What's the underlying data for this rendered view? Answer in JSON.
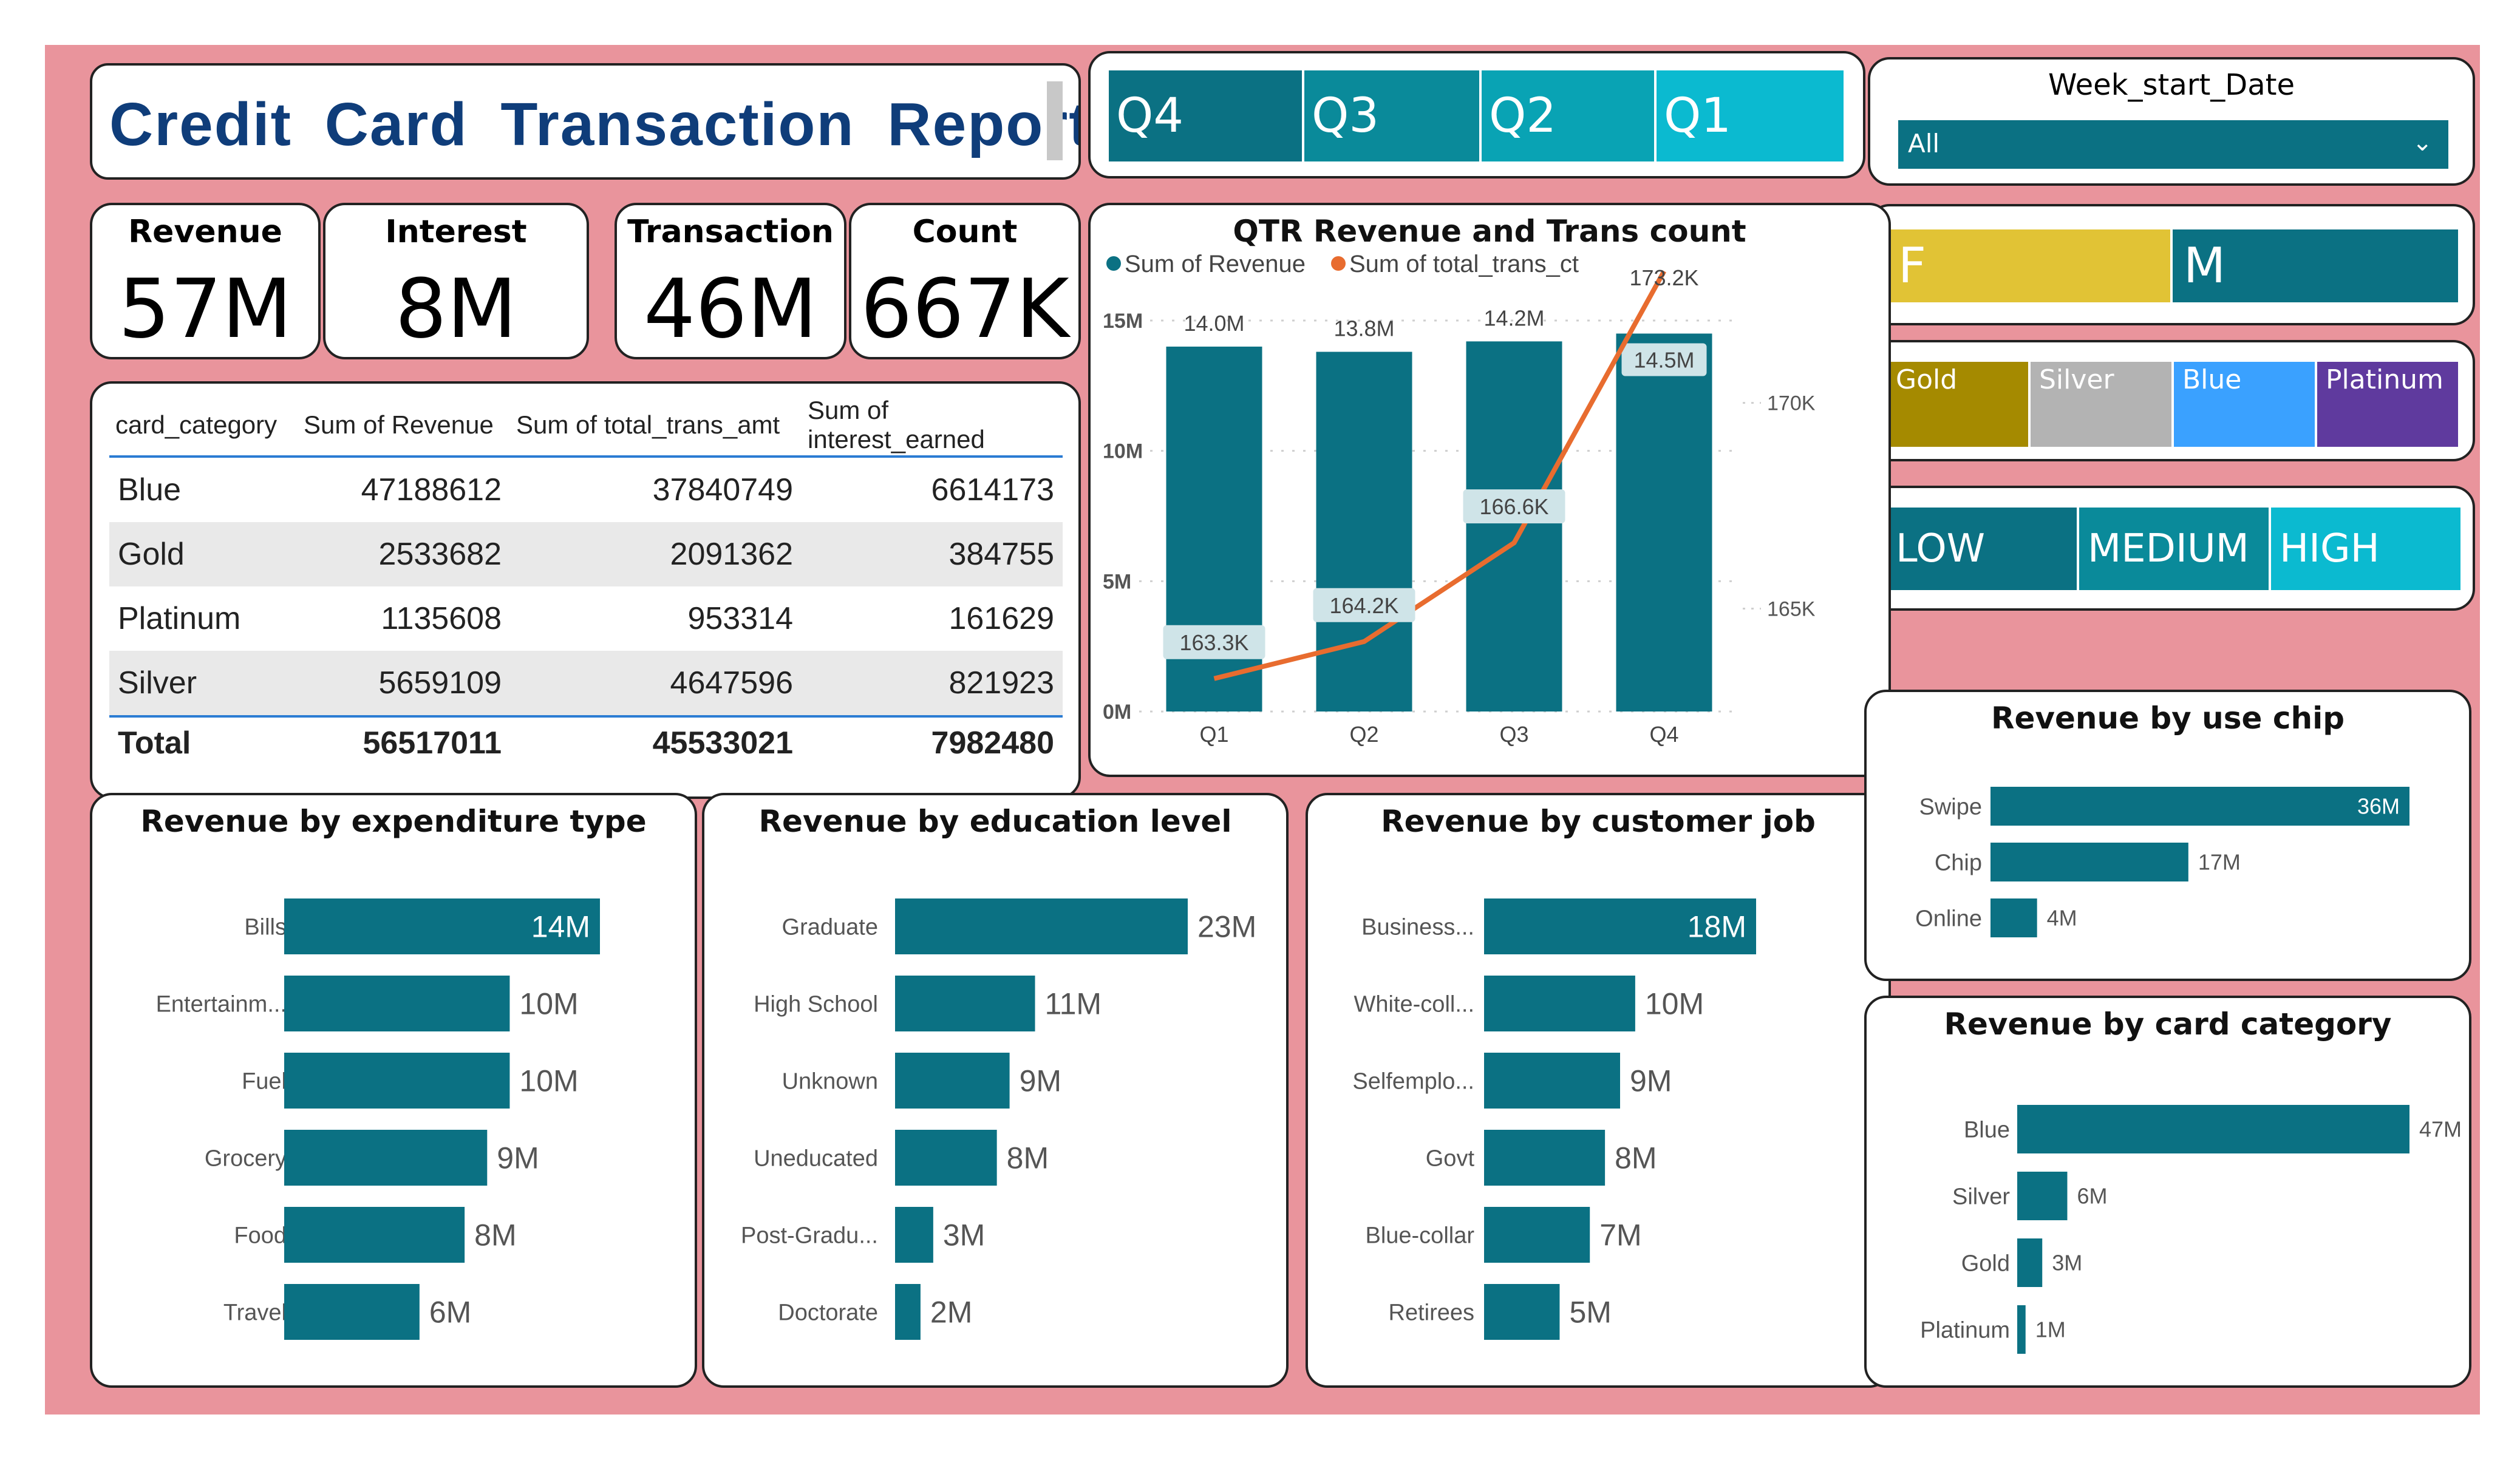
{
  "title": "Credit Card Transaction Report",
  "colors": {
    "teal": "#0b7183",
    "gold": "#a58a00",
    "silver": "#b3b3b3",
    "blue": "#3aa1ff",
    "platinum": "#5f3a9e",
    "line": "#e86c2f",
    "background": "#e9949c"
  },
  "quarter_tiles": [
    "Q4",
    "Q3",
    "Q2",
    "Q1"
  ],
  "week_filter": {
    "title": "Week_start_Date",
    "value": "All"
  },
  "gender_tiles": [
    "F",
    "M"
  ],
  "category_tiles": [
    "Gold",
    "Silver",
    "Blue",
    "Platinum"
  ],
  "income_tiles": [
    "LOW",
    "MEDIUM",
    "HIGH"
  ],
  "kpis": [
    {
      "label": "Revenue",
      "value": "57M"
    },
    {
      "label": "Interest",
      "value": "8M"
    },
    {
      "label": "Transaction",
      "value": "46M"
    },
    {
      "label": "Count",
      "value": "667K"
    }
  ],
  "table": {
    "headers": [
      "card_category",
      "Sum of Revenue",
      "Sum of total_trans_amt",
      "Sum of interest_earned"
    ],
    "rows": [
      [
        "Blue",
        "47188612",
        "37840749",
        "6614173"
      ],
      [
        "Gold",
        "2533682",
        "2091362",
        "384755"
      ],
      [
        "Platinum",
        "1135608",
        "953314",
        "161629"
      ],
      [
        "Silver",
        "5659109",
        "4647596",
        "821923"
      ]
    ],
    "total": [
      "Total",
      "56517011",
      "45533021",
      "7982480"
    ]
  },
  "chart_data": [
    {
      "type": "bar+line",
      "title": "QTR Revenue and Trans count",
      "legend": [
        "Sum of Revenue",
        "Sum of total_trans_ct"
      ],
      "legend_position": "top-left",
      "categories": [
        "Q1",
        "Q2",
        "Q3",
        "Q4"
      ],
      "series": [
        {
          "name": "Sum of Revenue",
          "type": "bar",
          "axis": "left",
          "values": [
            14.0,
            13.8,
            14.2,
            14.5
          ],
          "labels": [
            "14.0M",
            "13.8M",
            "14.2M",
            "14.5M"
          ]
        },
        {
          "name": "Sum of total_trans_ct",
          "type": "line",
          "axis": "right",
          "values": [
            163.3,
            164.2,
            166.6,
            173.2
          ],
          "labels": [
            "163.3K",
            "164.2K",
            "166.6K",
            "173.2K"
          ]
        }
      ],
      "y_left": {
        "ticks": [
          "0M",
          "5M",
          "10M",
          "15M"
        ],
        "ylim": [
          0,
          15
        ]
      },
      "y_right": {
        "ticks": [
          "165K",
          "170K"
        ],
        "ylim": [
          162.5,
          172
        ]
      },
      "grid": true
    },
    {
      "type": "bar",
      "orientation": "horizontal",
      "title": "Revenue by expenditure type",
      "categories": [
        "Bills",
        "Entertainm...",
        "Fuel",
        "Grocery",
        "Food",
        "Travel"
      ],
      "values": [
        14,
        10,
        10,
        9,
        8,
        6
      ],
      "labels": [
        "14M",
        "10M",
        "10M",
        "9M",
        "8M",
        "6M"
      ]
    },
    {
      "type": "bar",
      "orientation": "horizontal",
      "title": "Revenue by education level",
      "categories": [
        "Graduate",
        "High School",
        "Unknown",
        "Uneducated",
        "Post-Gradu...",
        "Doctorate"
      ],
      "values": [
        23,
        11,
        9,
        8,
        3,
        2
      ],
      "labels": [
        "23M",
        "11M",
        "9M",
        "8M",
        "3M",
        "2M"
      ]
    },
    {
      "type": "bar",
      "orientation": "horizontal",
      "title": "Revenue by customer job",
      "categories": [
        "Business...",
        "White-coll...",
        "Selfemplo...",
        "Govt",
        "Blue-collar",
        "Retirees"
      ],
      "values": [
        18,
        10,
        9,
        8,
        7,
        5
      ],
      "labels": [
        "18M",
        "10M",
        "9M",
        "8M",
        "7M",
        "5M"
      ]
    },
    {
      "type": "bar",
      "orientation": "horizontal",
      "title": "Revenue by use chip",
      "categories": [
        "Swipe",
        "Chip",
        "Online"
      ],
      "values": [
        36,
        17,
        4
      ],
      "labels": [
        "36M",
        "17M",
        "4M"
      ]
    },
    {
      "type": "bar",
      "orientation": "horizontal",
      "title": "Revenue by card category",
      "categories": [
        "Blue",
        "Silver",
        "Gold",
        "Platinum"
      ],
      "values": [
        47,
        6,
        3,
        1
      ],
      "labels": [
        "47M",
        "6M",
        "3M",
        "1M"
      ]
    }
  ]
}
